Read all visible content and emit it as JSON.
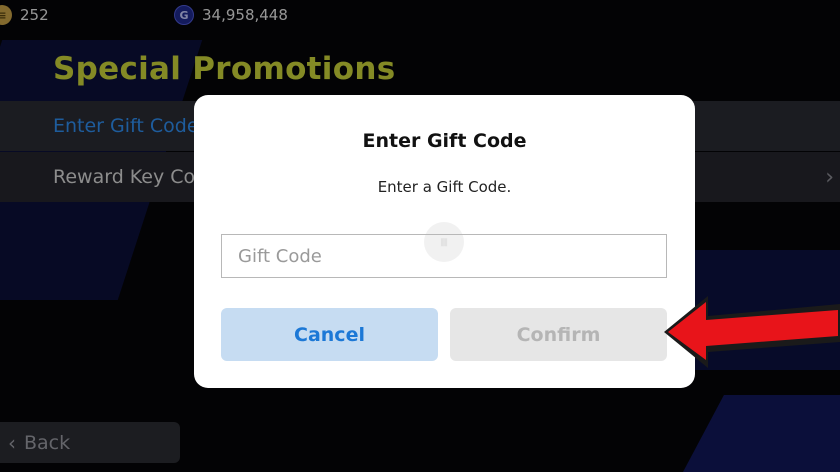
{
  "currency": {
    "coins": "252",
    "gp": "34,958,448",
    "gp_icon_letter": "G"
  },
  "page": {
    "title": "Special Promotions"
  },
  "menu": {
    "items": [
      {
        "label": "Enter Gift Code"
      },
      {
        "label": "Reward Key Code"
      }
    ]
  },
  "navigation": {
    "back_label": "Back"
  },
  "dialog": {
    "title": "Enter Gift Code",
    "subtitle": "Enter a Gift Code.",
    "input_placeholder": "Gift Code",
    "input_value": "",
    "cancel_label": "Cancel",
    "confirm_label": "Confirm"
  },
  "colors": {
    "title_yellow": "#cbd43a",
    "active_blue": "#2e8ef0",
    "annotation_red": "#e8141a"
  }
}
